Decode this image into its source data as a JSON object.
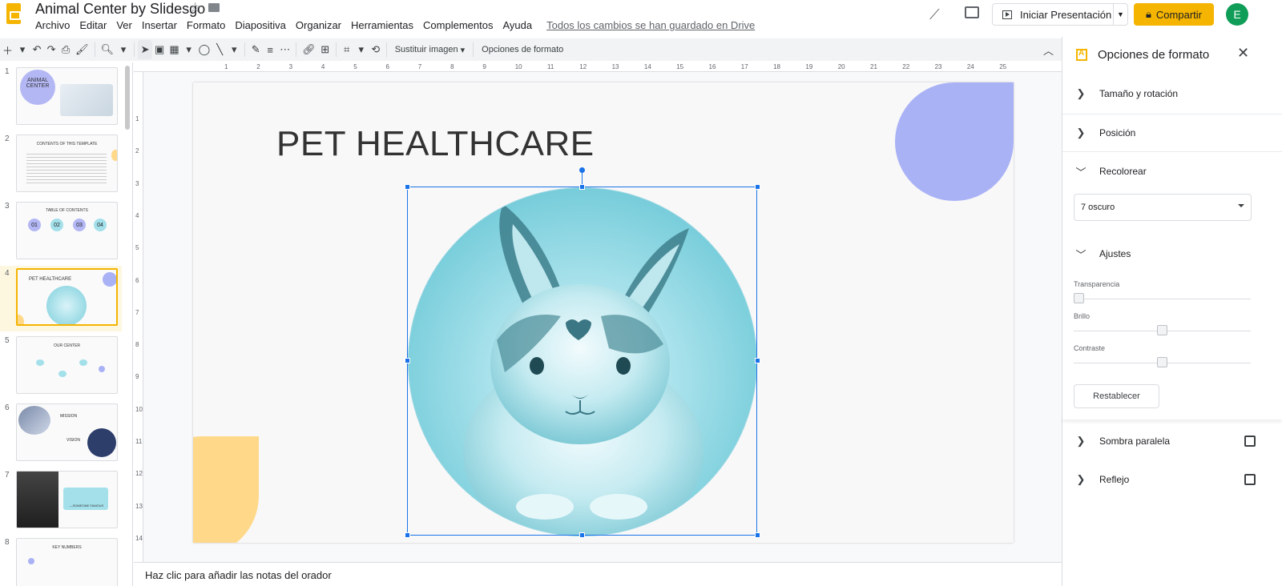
{
  "app": {
    "doc_title": "Animal Center by Slidesgo",
    "menu": [
      "Archivo",
      "Editar",
      "Ver",
      "Insertar",
      "Formato",
      "Diapositiva",
      "Organizar",
      "Herramientas",
      "Complementos",
      "Ayuda"
    ],
    "saved_status": "Todos los cambios se han guardado en Drive",
    "present_label": "Iniciar Presentación",
    "share_label": "Compartir",
    "avatar_initial": "E",
    "brand_color": "#f4b400"
  },
  "toolbar": {
    "replace_image": "Sustituir imagen",
    "format_options": "Opciones de formato"
  },
  "ruler": {
    "h_ticks": [
      "1",
      "2",
      "3",
      "4",
      "5",
      "6",
      "7",
      "8",
      "9",
      "10",
      "11",
      "12",
      "13",
      "14",
      "15",
      "16",
      "17",
      "18",
      "19",
      "20",
      "21",
      "22",
      "23",
      "24",
      "25"
    ],
    "v_ticks": [
      "1",
      "2",
      "3",
      "4",
      "5",
      "6",
      "7",
      "8",
      "9",
      "10",
      "11",
      "12",
      "13",
      "14"
    ]
  },
  "filmstrip": {
    "slides": [
      {
        "num": "1",
        "title": "ANIMAL CENTER"
      },
      {
        "num": "2",
        "title": "CONTENTS OF THIS TEMPLATE"
      },
      {
        "num": "3",
        "title": "TABLE OF CONTENTS",
        "items": [
          "01",
          "02",
          "03",
          "04"
        ]
      },
      {
        "num": "4",
        "title": "PET HEALTHCARE"
      },
      {
        "num": "5",
        "title": "OUR CENTER"
      },
      {
        "num": "6",
        "title": "MISSION",
        "subtitle": "VISION"
      },
      {
        "num": "7",
        "title": "—SOMEONE FAMOUS"
      },
      {
        "num": "8",
        "title": "KEY NUMBERS"
      }
    ]
  },
  "slide": {
    "title": "PET HEALTHCARE"
  },
  "notes": {
    "placeholder": "Haz clic para añadir las notas del orador"
  },
  "panel": {
    "title": "Opciones de formato",
    "sections": {
      "size": "Tamaño y rotación",
      "position": "Posición",
      "recolor": "Recolorear",
      "adjust": "Ajustes",
      "shadow": "Sombra paralela",
      "reflection": "Reflejo"
    },
    "recolor_value": "7 oscuro",
    "sliders": {
      "transparency": {
        "label": "Transparencia",
        "value": 0.0
      },
      "brightness": {
        "label": "Brillo",
        "value": 0.5
      },
      "contrast": {
        "label": "Contraste",
        "value": 0.5
      }
    },
    "reset_label": "Restablecer"
  }
}
